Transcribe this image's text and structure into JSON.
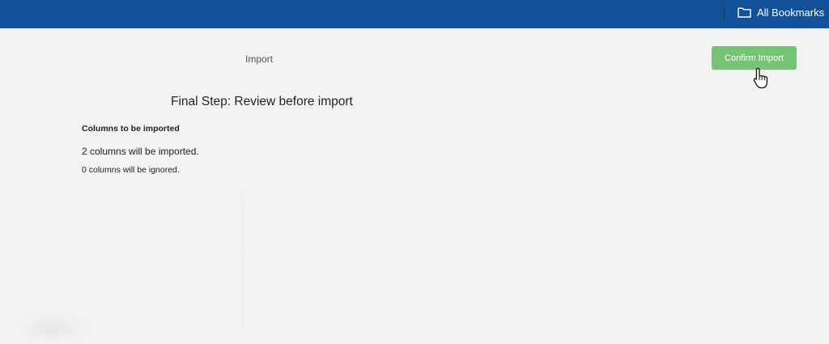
{
  "header": {
    "bookmarks_label": "All Bookmarks",
    "bookmarks_icon": "folder-icon",
    "bar_color": "#12519a"
  },
  "page": {
    "breadcrumb": "Import",
    "confirm_button_label": "Confirm Import",
    "confirm_button_color": "#74c474",
    "title": "Final Step: Review before import",
    "section_heading": "Columns to be imported",
    "imported_summary": "2 columns will be imported.",
    "ignored_summary": "0 columns will be ignored."
  }
}
